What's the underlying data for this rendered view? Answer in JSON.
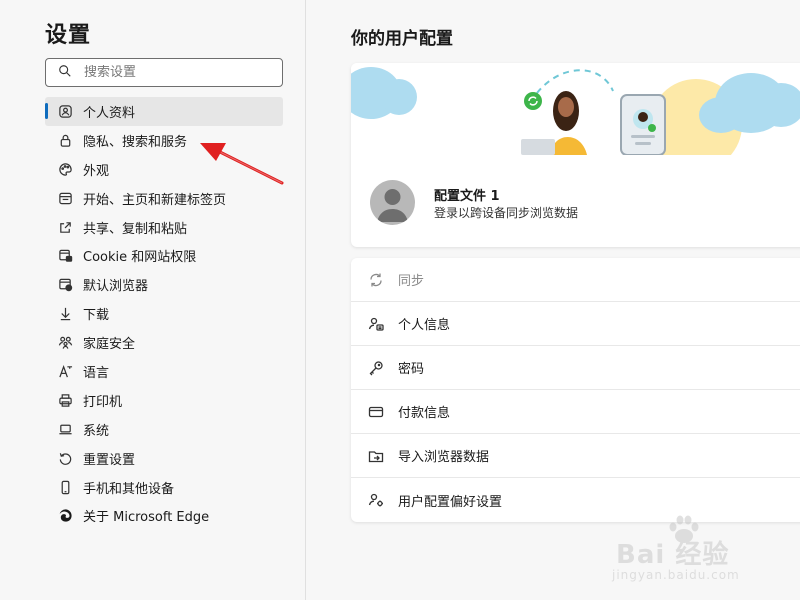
{
  "sidebar": {
    "title": "设置",
    "search_placeholder": "搜索设置",
    "items": [
      {
        "label": "个人资料",
        "icon": "profile-icon",
        "active": true
      },
      {
        "label": "隐私、搜索和服务",
        "icon": "lock-icon"
      },
      {
        "label": "外观",
        "icon": "palette-icon"
      },
      {
        "label": "开始、主页和新建标签页",
        "icon": "home-tab-icon"
      },
      {
        "label": "共享、复制和粘贴",
        "icon": "share-icon"
      },
      {
        "label": "Cookie 和网站权限",
        "icon": "cookie-icon"
      },
      {
        "label": "默认浏览器",
        "icon": "browser-icon"
      },
      {
        "label": "下载",
        "icon": "download-icon"
      },
      {
        "label": "家庭安全",
        "icon": "family-icon"
      },
      {
        "label": "语言",
        "icon": "language-icon"
      },
      {
        "label": "打印机",
        "icon": "printer-icon"
      },
      {
        "label": "系统",
        "icon": "laptop-icon"
      },
      {
        "label": "重置设置",
        "icon": "reset-icon"
      },
      {
        "label": "手机和其他设备",
        "icon": "phone-icon"
      },
      {
        "label": "关于 Microsoft Edge",
        "icon": "edge-icon"
      }
    ]
  },
  "main": {
    "title": "你的用户配置",
    "profile": {
      "name": "配置文件 1",
      "subtitle": "登录以跨设备同步浏览数据"
    },
    "rows": [
      {
        "label": "同步",
        "icon": "sync-icon",
        "disabled": true
      },
      {
        "label": "个人信息",
        "icon": "person-card-icon"
      },
      {
        "label": "密码",
        "icon": "key-icon"
      },
      {
        "label": "付款信息",
        "icon": "credit-card-icon"
      },
      {
        "label": "导入浏览器数据",
        "icon": "import-folder-icon"
      },
      {
        "label": "用户配置偏好设置",
        "icon": "person-gear-icon"
      }
    ]
  },
  "watermark": {
    "text": "Bai 经验",
    "sub": "jingyan.baidu.com"
  },
  "colors": {
    "accent": "#0f6cbd",
    "arrow": "#e02020",
    "cloud": "#aedcf0",
    "sun": "#fde9a8"
  }
}
